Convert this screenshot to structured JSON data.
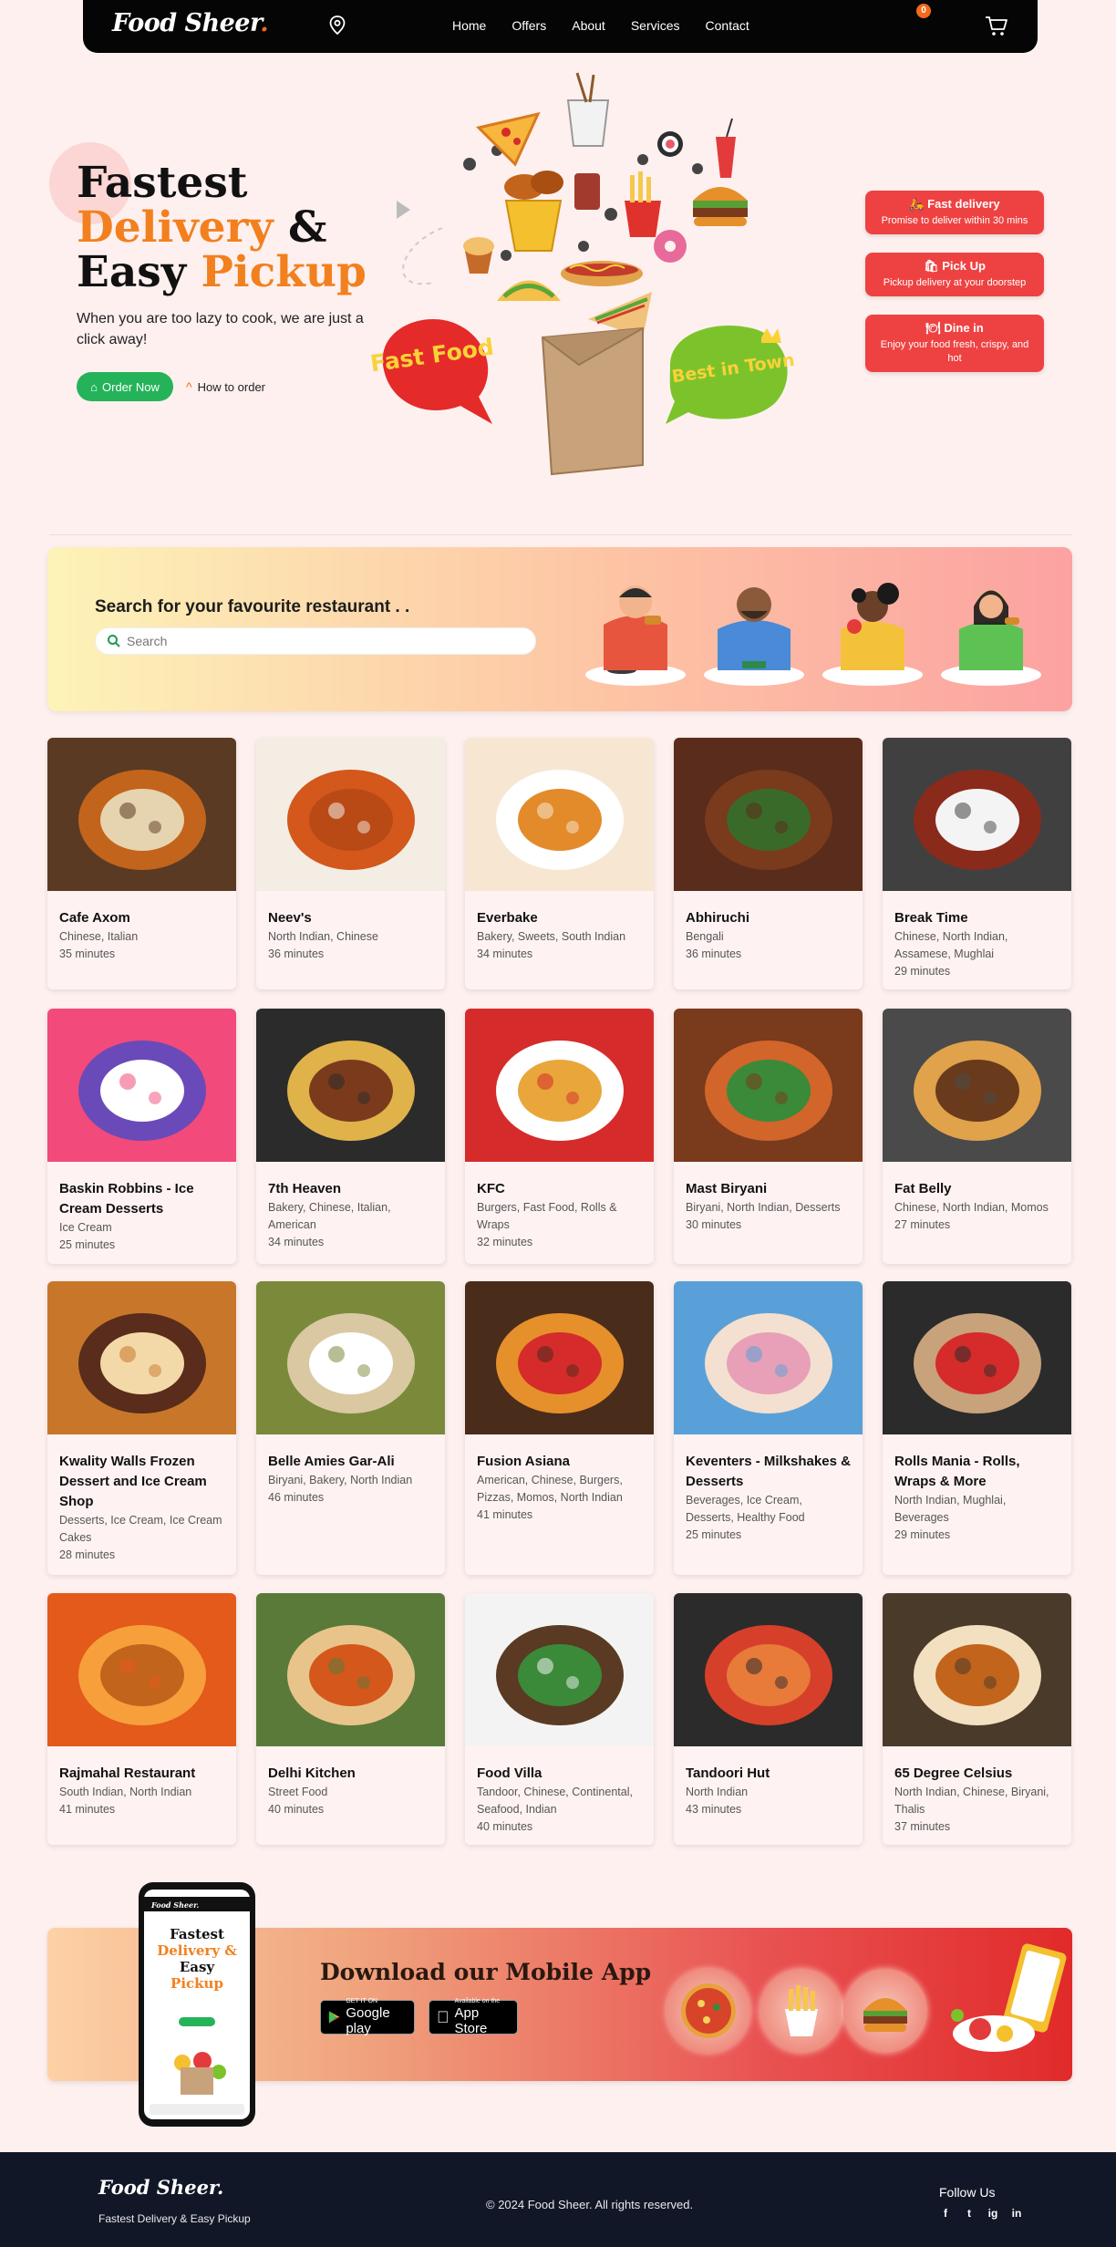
{
  "brand": {
    "name": "Food Sheer",
    "dot": "."
  },
  "nav": {
    "links": [
      "Home",
      "Offers",
      "About",
      "Services",
      "Contact"
    ],
    "cart_count": "0"
  },
  "hero": {
    "line1": "Fastest",
    "line2a": "Delivery",
    "line2b": "&",
    "line3a": "Easy",
    "line3b": "Pickup",
    "subtitle": "When you are too lazy to cook, we are just a click away!",
    "order_button": "Order Now",
    "how_to": "How to order",
    "badge_left": "Fast Food",
    "badge_right": "Best in Town"
  },
  "features": [
    {
      "icon": "scooter-icon",
      "title": "Fast delivery",
      "desc": "Promise to deliver within 30 mins"
    },
    {
      "icon": "bag-icon",
      "title": "Pick Up",
      "desc": "Pickup delivery at your doorstep"
    },
    {
      "icon": "dish-icon",
      "title": "Dine in",
      "desc": "Enjoy your food fresh, crispy, and hot"
    }
  ],
  "search": {
    "title": "Search for your favourite restaurant . .",
    "placeholder": "Search"
  },
  "restaurants": [
    {
      "name": "Cafe Axom",
      "cuisine": "Chinese, Italian",
      "time": "35 minutes"
    },
    {
      "name": "Neev's",
      "cuisine": "North Indian, Chinese",
      "time": "36 minutes"
    },
    {
      "name": "Everbake",
      "cuisine": "Bakery, Sweets, South Indian",
      "time": "34 minutes"
    },
    {
      "name": "Abhiruchi",
      "cuisine": "Bengali",
      "time": "36 minutes"
    },
    {
      "name": "Break Time",
      "cuisine": "Chinese, North Indian, Assamese, Mughlai",
      "time": "29 minutes"
    },
    {
      "name": "Baskin Robbins - Ice Cream Desserts",
      "cuisine": "Ice Cream",
      "time": "25 minutes"
    },
    {
      "name": "7th Heaven",
      "cuisine": "Bakery, Chinese, Italian, American",
      "time": "34 minutes"
    },
    {
      "name": "KFC",
      "cuisine": "Burgers, Fast Food, Rolls & Wraps",
      "time": "32 minutes"
    },
    {
      "name": "Mast Biryani",
      "cuisine": "Biryani, North Indian, Desserts",
      "time": "30 minutes"
    },
    {
      "name": "Fat Belly",
      "cuisine": "Chinese, North Indian, Momos",
      "time": "27 minutes"
    },
    {
      "name": "Kwality Walls Frozen Dessert and Ice Cream Shop",
      "cuisine": "Desserts, Ice Cream, Ice Cream Cakes",
      "time": "28 minutes"
    },
    {
      "name": "Belle Amies Gar-Ali",
      "cuisine": "Biryani, Bakery, North Indian",
      "time": "46 minutes"
    },
    {
      "name": "Fusion Asiana",
      "cuisine": "American, Chinese, Burgers, Pizzas, Momos, North Indian",
      "time": "41 minutes"
    },
    {
      "name": "Keventers - Milkshakes & Desserts",
      "cuisine": "Beverages, Ice Cream, Desserts, Healthy Food",
      "time": "25 minutes"
    },
    {
      "name": "Rolls Mania - Rolls, Wraps & More",
      "cuisine": "North Indian, Mughlai, Beverages",
      "time": "29 minutes"
    },
    {
      "name": "Rajmahal Restaurant",
      "cuisine": "South Indian, North Indian",
      "time": "41 minutes"
    },
    {
      "name": "Delhi Kitchen",
      "cuisine": "Street Food",
      "time": "40 minutes"
    },
    {
      "name": "Food Villa",
      "cuisine": "Tandoor, Chinese, Continental, Seafood, Indian",
      "time": "40 minutes"
    },
    {
      "name": "Tandoori Hut",
      "cuisine": "North Indian",
      "time": "43 minutes"
    },
    {
      "name": "65 Degree Celsius",
      "cuisine": "North Indian, Chinese, Biryani, Thalis",
      "time": "37 minutes"
    }
  ],
  "app": {
    "title": "Download our Mobile App",
    "google_small": "GET IT ON",
    "google_big": "Google play",
    "apple_small": "Available on the",
    "apple_big": "App Store"
  },
  "footer": {
    "logo": "Food Sheer.",
    "tagline": "Fastest Delivery & Easy Pickup",
    "copyright": "© 2024 Food Sheer. All rights reserved.",
    "follow": "Follow Us",
    "socials": [
      "f",
      "t",
      "ig",
      "in"
    ]
  },
  "colors": {
    "accent": "#f2801e",
    "green": "#25b35a",
    "red": "#ee4242",
    "navbar": "#050505",
    "footer": "#121728",
    "page": "#fdf0ef"
  }
}
